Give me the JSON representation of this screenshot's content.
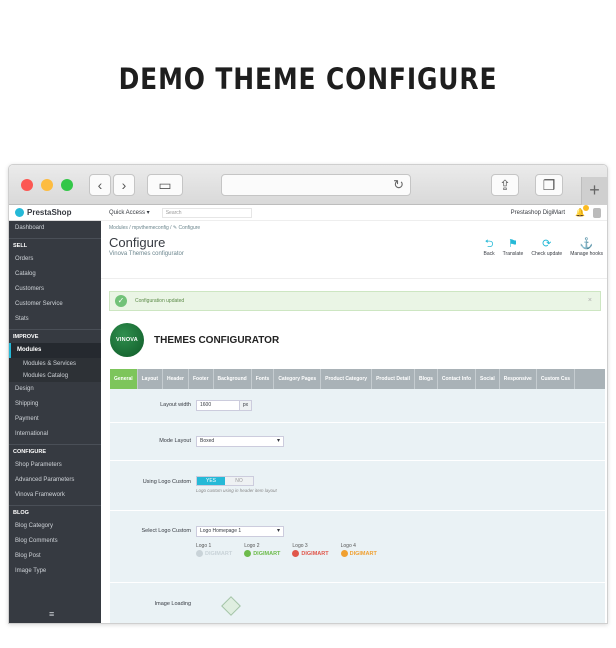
{
  "hero": {
    "title": "DEMO THEME CONFIGURE"
  },
  "browser": {
    "back_icon": "‹",
    "forward_icon": "›",
    "sidebar_icon": "▭",
    "reload_icon": "↻",
    "share_icon": "⇪",
    "tabs_icon": "❐",
    "plus_icon": "+"
  },
  "sidebar": {
    "brand": "PrestaShop",
    "dashboard": "Dashboard",
    "sections": [
      {
        "title": "SELL",
        "items": [
          "Orders",
          "Catalog",
          "Customers",
          "Customer Service",
          "Stats"
        ]
      },
      {
        "title": "IMPROVE",
        "items": [
          "Modules"
        ],
        "subitems": [
          "Modules & Services",
          "Modules Catalog"
        ],
        "after": [
          "Design",
          "Shipping",
          "Payment",
          "International"
        ]
      },
      {
        "title": "CONFIGURE",
        "items": [
          "Shop Parameters",
          "Advanced Parameters",
          "Vinova Framework"
        ]
      },
      {
        "title": "BLOG",
        "items": [
          "Blog Category",
          "Blog Comments",
          "Blog Post",
          "Image Type"
        ]
      }
    ],
    "menu_icon": "≡"
  },
  "topbar": {
    "quick_access": "Quick Access ▾",
    "search_placeholder": "Search",
    "shop_name": "Prestashop DigiMart"
  },
  "header": {
    "breadcrumb": "Modules  /  mpvthemeconfig  /  ✎ Configure",
    "title": "Configure",
    "subtitle": "Vinova Themes configurator",
    "toolbar": [
      {
        "icon": "⮌",
        "label": "Back"
      },
      {
        "icon": "⚑",
        "label": "Translate"
      },
      {
        "icon": "⟳",
        "label": "Check update"
      },
      {
        "icon": "⚓",
        "label": "Manage hooks"
      }
    ]
  },
  "alert": {
    "text": "Configuration updated",
    "close": "×",
    "check": "✓"
  },
  "configurator": {
    "logo_text": "VINOVA",
    "title": "THEMES CONFIGURATOR",
    "tabs": [
      "General",
      "Layout",
      "Header",
      "Footer",
      "Background",
      "Fonts",
      "Category Pages",
      "Product Category",
      "Product Detail",
      "Blogs",
      "Contact Info",
      "Social",
      "Responsive",
      "Custom Css"
    ],
    "active_tab": 0,
    "fields": {
      "layout_width": {
        "label": "Layout width",
        "value": "1600",
        "unit": "px"
      },
      "mode_layout": {
        "label": "Mode Layout",
        "value": "Boxed"
      },
      "logo_custom": {
        "label": "Using Logo Custom",
        "yes": "YES",
        "no": "NO",
        "help": "Logo custom using in header item layout"
      },
      "select_logo": {
        "label": "Select Logo Custom",
        "value": "Logo Homepage 1",
        "options": [
          {
            "caption": "Logo 1",
            "name": "DIGIMART",
            "color": "#c9d3d8"
          },
          {
            "caption": "Logo 2",
            "name": "DIGIMART",
            "color": "#6dbb4b"
          },
          {
            "caption": "Logo 3",
            "name": "DIGIMART",
            "color": "#e0574b"
          },
          {
            "caption": "Logo 4",
            "name": "DIGIMART",
            "color": "#f0a030"
          }
        ]
      },
      "image_loading": {
        "label": "Image Loading"
      }
    }
  }
}
